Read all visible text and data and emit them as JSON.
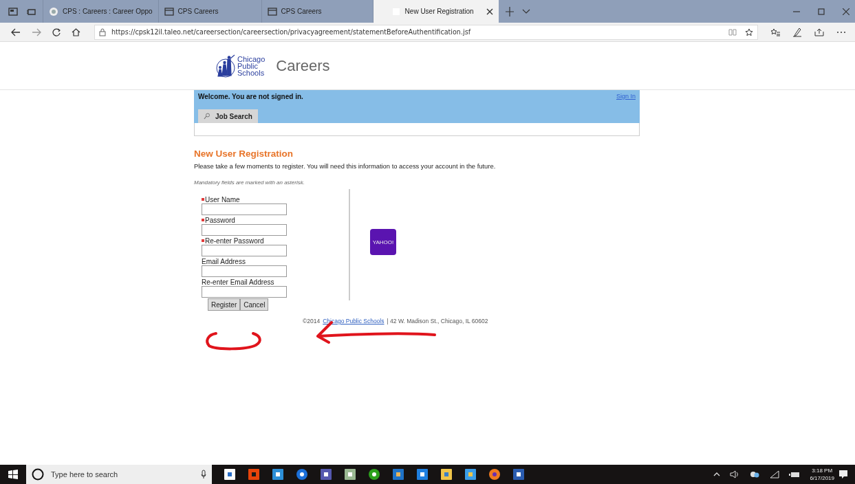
{
  "browser": {
    "tabs": [
      {
        "title": "CPS : Careers : Career Oppo",
        "selected": false
      },
      {
        "title": "CPS Careers",
        "selected": false
      },
      {
        "title": "CPS Careers",
        "selected": false
      },
      {
        "title": "New User Registration",
        "selected": true
      }
    ],
    "url": "https://cpsk12il.taleo.net/careersection/careersection/privacyagreement/statementBeforeAuthentification.jsf"
  },
  "header": {
    "logo_lines": [
      "Chicago",
      "Public",
      "Schools"
    ],
    "title": "Careers"
  },
  "banner": {
    "welcome": "Welcome. You are not signed in.",
    "sign_in": "Sign In",
    "tab": "Job Search"
  },
  "page": {
    "title": "New User Registration",
    "intro": "Please take a few moments to register. You will need this information to access your account in the future.",
    "note": "Mandatory fields are marked with an asterisk."
  },
  "fields": [
    {
      "label": "User Name",
      "required": true
    },
    {
      "label": "Password",
      "required": true
    },
    {
      "label": "Re-enter Password",
      "required": true
    },
    {
      "label": "Email Address",
      "required": false
    },
    {
      "label": "Re-enter Email Address",
      "required": false
    }
  ],
  "buttons": [
    "Register",
    "Cancel"
  ],
  "yahoo": {
    "label": "YAHOO!"
  },
  "footer": {
    "copyright": "©2014",
    "link": "Chicago Public Schools",
    "address": "| 42 W. Madison St., Chicago, IL 60602"
  },
  "taskbar": {
    "search_placeholder": "Type here to search",
    "time": "3:18 PM",
    "date": "6/17/2019"
  }
}
